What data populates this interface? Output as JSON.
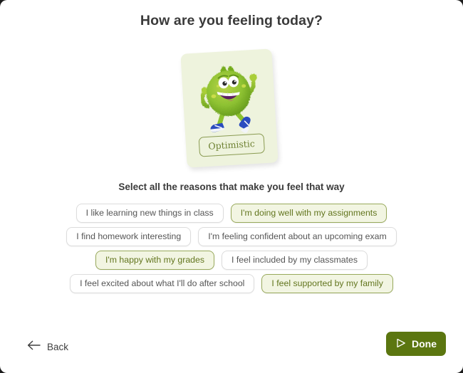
{
  "window": {
    "background": "#ffffff"
  },
  "header": {
    "title": "How are you feeling today?"
  },
  "mood_card": {
    "label": "Optimistic",
    "card_background": "#eef3dd",
    "label_color": "#6f8233",
    "avatar_name": "green-furry-monster-character"
  },
  "prompt": {
    "subtitle": "Select all the reasons that make you feel that way"
  },
  "reasons": {
    "selected_color": "#63761f",
    "selected_background": "#f2f5e2",
    "selected_border": "#98a95b",
    "unselected_color": "#555555",
    "rows": [
      [
        {
          "label": "I like learning new things in class",
          "selected": false
        },
        {
          "label": "I'm doing well with my assignments",
          "selected": true
        }
      ],
      [
        {
          "label": "I find homework interesting",
          "selected": false
        },
        {
          "label": "I'm feeling confident about an upcoming exam",
          "selected": false
        }
      ],
      [
        {
          "label": "I'm happy with my grades",
          "selected": true
        },
        {
          "label": "I feel included by my classmates",
          "selected": false
        }
      ],
      [
        {
          "label": "I feel excited about what I'll do after school",
          "selected": false
        },
        {
          "label": "I feel supported by my family",
          "selected": true
        }
      ]
    ]
  },
  "footer": {
    "back_label": "Back",
    "back_icon": "arrow-left-icon",
    "done_label": "Done",
    "done_icon": "play-triangle-icon",
    "done_background": "#5b7610"
  }
}
